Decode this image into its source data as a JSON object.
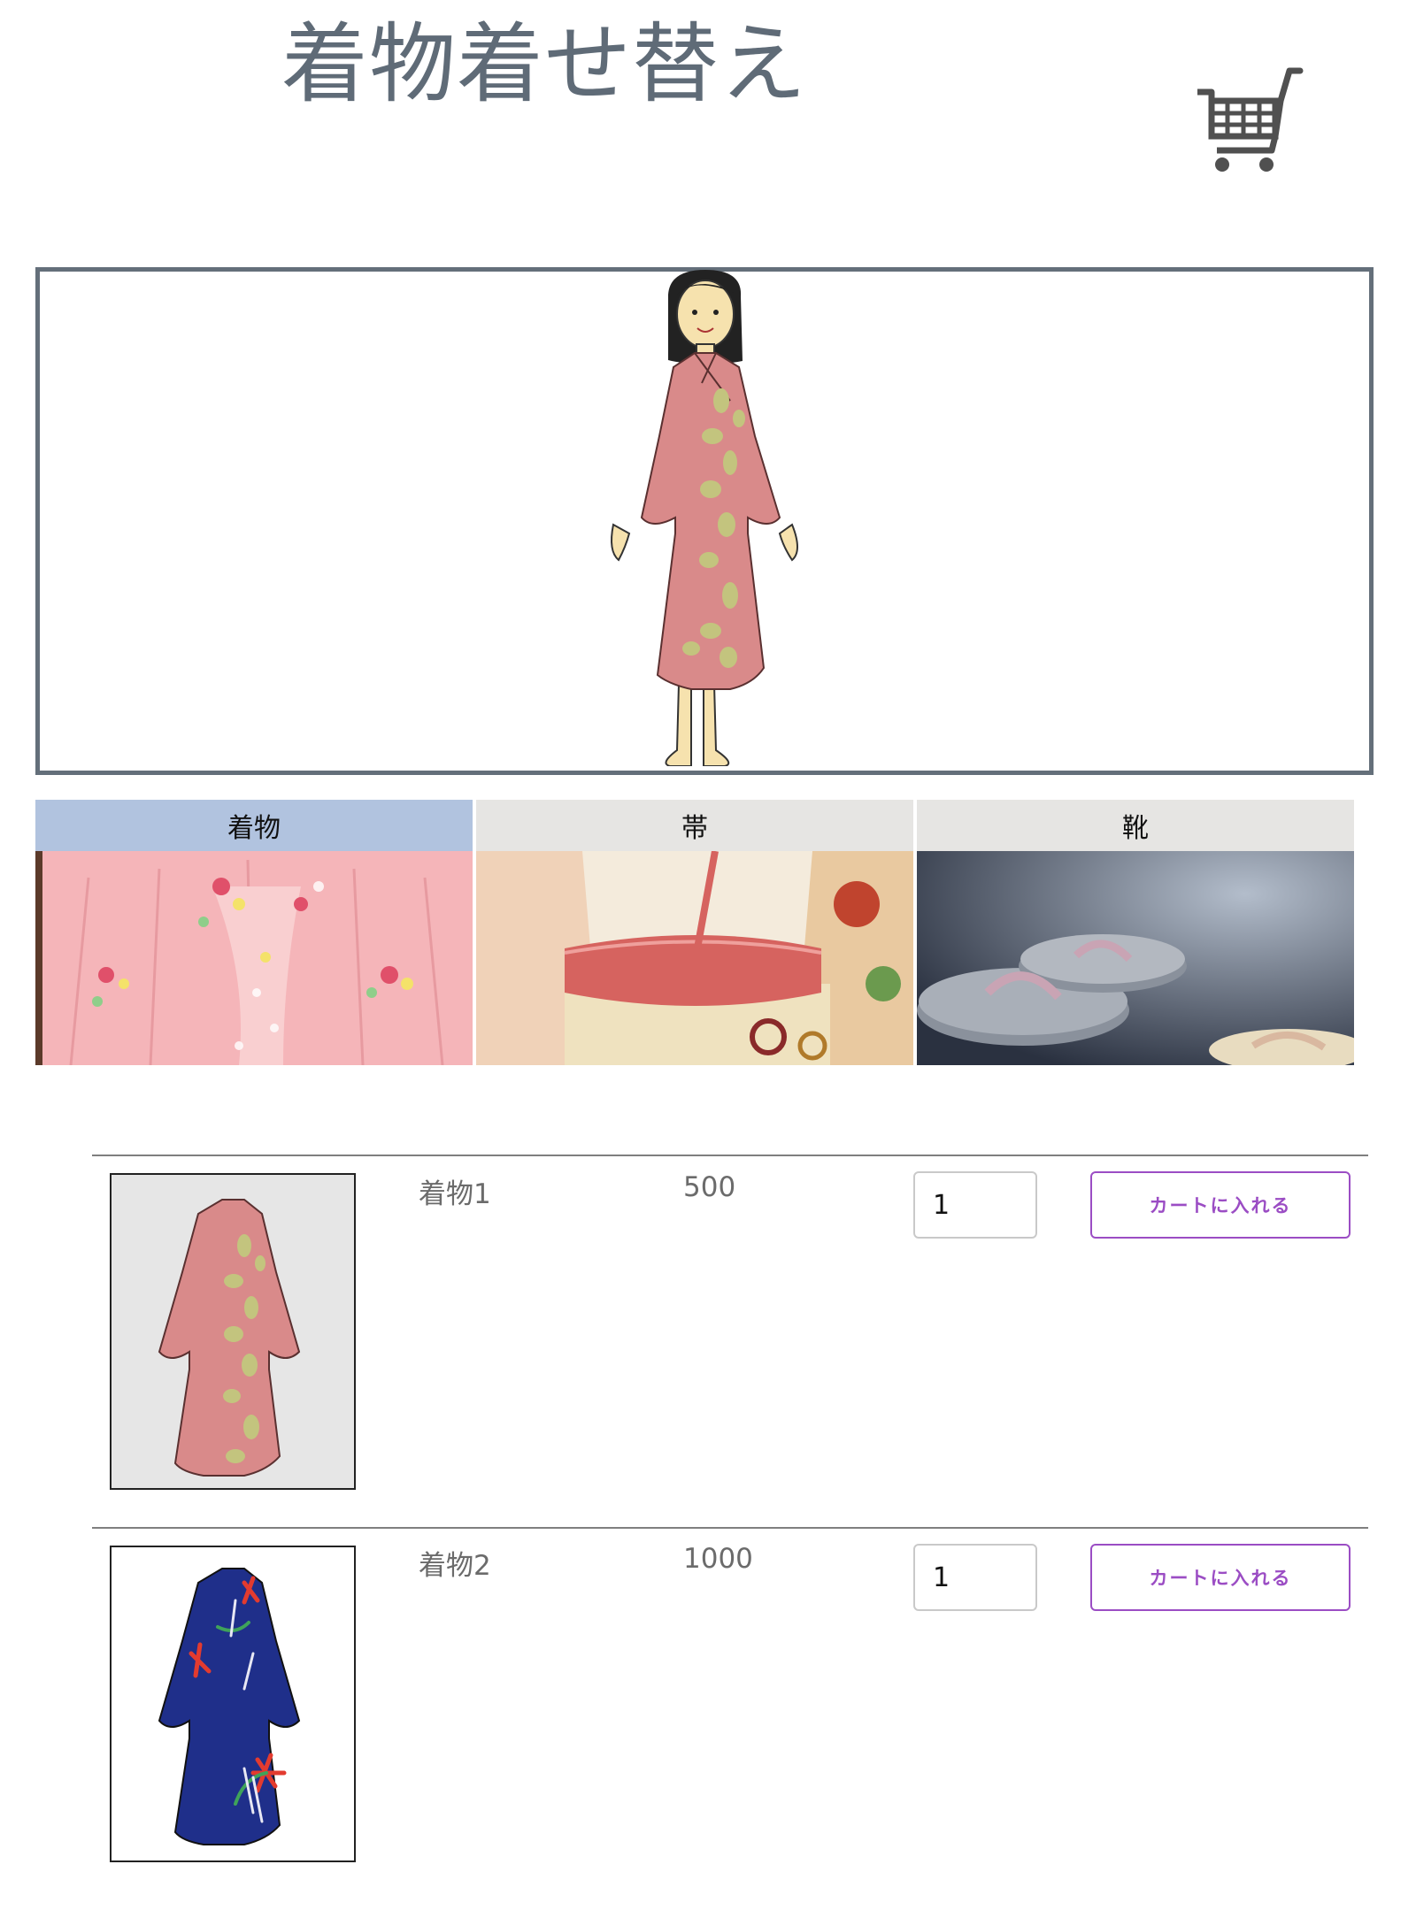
{
  "header": {
    "title": "着物着せ替え",
    "cart_icon": "shopping-cart-icon"
  },
  "tabs": [
    {
      "label": "着物",
      "active": true,
      "image": "pink-kimono-photo"
    },
    {
      "label": "帯",
      "active": false,
      "image": "obi-photo"
    },
    {
      "label": "靴",
      "active": false,
      "image": "zori-sandals-photo"
    }
  ],
  "colors": {
    "title": "#5f6b77",
    "active_tab": "#b1c3df",
    "inactive_tab": "#e6e5e3",
    "button_accent": "#9b4dc4",
    "pink_kimono": "#d98a8a",
    "pattern": "#c3c47e",
    "navy_kimono": "#1f2f8a"
  },
  "products": [
    {
      "name": "着物1",
      "price": "500",
      "quantity": "1",
      "button": "カートに入れる",
      "thumb_bg": "#e6e6e6"
    },
    {
      "name": "着物2",
      "price": "1000",
      "quantity": "1",
      "button": "カートに入れる",
      "thumb_bg": "#ffffff"
    }
  ]
}
